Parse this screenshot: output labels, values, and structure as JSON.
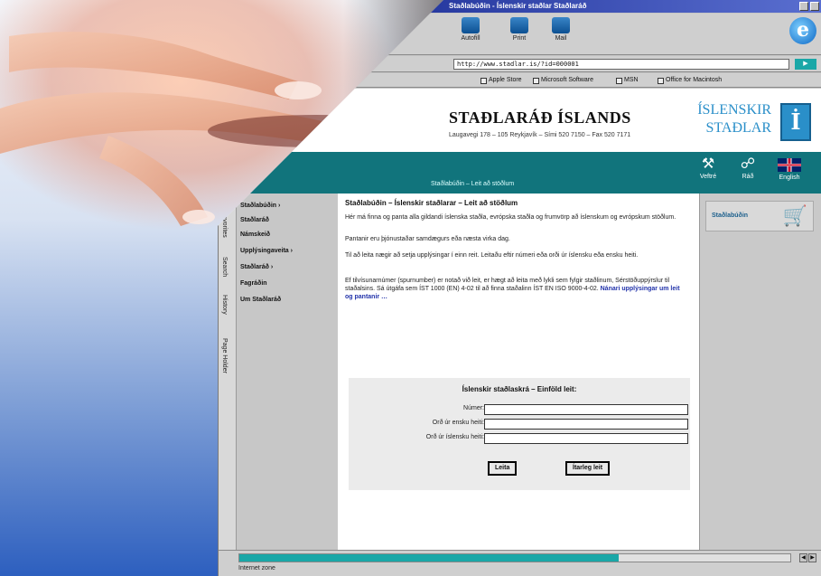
{
  "window": {
    "title": "Staðlabúðin - Íslenskir staðlar Staðlaráð"
  },
  "toolbar": {
    "buttons": [
      "Autofill",
      "Print",
      "Mail"
    ]
  },
  "address": {
    "url": "http://www.stadlar.is/?id=000001"
  },
  "links_bar": {
    "items": [
      "Apple Store",
      "Microsoft Software",
      "MSN",
      "Office for Macintosh"
    ]
  },
  "banner": {
    "brand": "STAÐLARÁÐ ÍSLANDS",
    "subline": "Laugavegi 178 – 105 Reykjavík – Sími 520 7150 – Fax 520 7171",
    "logo_line1": "ÍSLENSKIR",
    "logo_line2": "STAÐLAR",
    "logo_glyph": "İ"
  },
  "navband": {
    "breadcrumb": "Staðlabúðin – Leit að stöðlum",
    "icons": [
      {
        "label": "Veftré",
        "glyph": "⚒",
        "icon": "sitemap-icon"
      },
      {
        "label": "Ráð",
        "glyph": "☍",
        "icon": "people-icon"
      },
      {
        "label": "English",
        "icon": "uk-flag-icon"
      }
    ]
  },
  "sidetabs": [
    "Favorites",
    "Search",
    "History",
    "Page Holder"
  ],
  "leftnav": {
    "items": [
      "Staðlabúðin ›",
      "Staðlaráð",
      "Námskeið",
      "Upplýsingaveita ›",
      "Staðlaráð ›",
      "Fagráðin",
      "Um Staðlaráð"
    ]
  },
  "content": {
    "heading": "Staðlabúðin – Íslenskir staðlarar – Leit að stöðlum",
    "para1": "Hér má finna og panta alla gildandi íslenska staðla, evrópska staðla og frumvörp að íslenskum og evrópskum stöðlum.",
    "para2": "Pantanir eru þjónustaðar samdægurs eða næsta virka dag.",
    "para3": "Til að leita nægir að setja upplýsingar í einn reit. Leitaðu eftir númeri eða orði úr íslensku eða ensku heiti.",
    "para4": "Ef tilvísunarnúmer (spurnumber) er notað við leit, er hægt að leita með lykli sem fylgir staðlinum, Sérstöðuppýrslur til staðalsins. Sá útgáfa sem ÍST 1000 (EN) 4-02 til að finna staðalinn ÍST EN ISO 9000-4-02.",
    "more_link": "Nánari upplýsingar um leit og pantanir …",
    "search": {
      "title": "Íslenskir staðlaskrá – Einföld leit:",
      "fields": [
        {
          "label": "Númer:",
          "value": ""
        },
        {
          "label": "Orð úr ensku heiti:",
          "value": ""
        },
        {
          "label": "Orð úr íslensku heiti:",
          "value": ""
        }
      ],
      "search_button": "Leita",
      "advanced_button": "Ítarleg leit"
    }
  },
  "rightcol": {
    "cart_label": "Staðlabúðin"
  },
  "statusbar": {
    "text": "Internet zone"
  },
  "colors": {
    "teal": "#11747c",
    "accent": "#1aa7a7",
    "brand_blue": "#2a8fc9"
  }
}
